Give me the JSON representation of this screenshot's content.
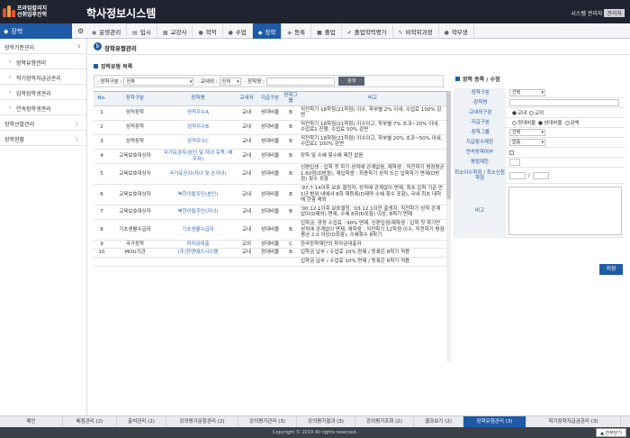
{
  "header": {
    "logo_line1": "프라임칼리지",
    "logo_line2": "선취업후진학",
    "system_title": "학사정보시스템",
    "user_label": "시스템 관리자",
    "user_name": "관리자"
  },
  "menubar": {
    "current": "장학",
    "items": [
      {
        "label": "운영관리",
        "icon": "◉"
      },
      {
        "label": "입시",
        "icon": "▤"
      },
      {
        "label": "교강사",
        "icon": "▦"
      },
      {
        "label": "학적",
        "icon": "●"
      },
      {
        "label": "수업",
        "icon": "●"
      },
      {
        "label": "장학",
        "icon": "◆"
      },
      {
        "label": "등록",
        "icon": "◈"
      },
      {
        "label": "졸업",
        "icon": "■"
      },
      {
        "label": "졸업학력평가",
        "icon": "✔"
      },
      {
        "label": "비학위과정",
        "icon": "✎"
      },
      {
        "label": "학부생",
        "icon": "●"
      }
    ]
  },
  "sidebar": {
    "items": [
      {
        "label": "장학기준관리",
        "type": "group",
        "chevron": "∨"
      },
      {
        "label": "장학유형관리",
        "type": "sub",
        "selected": true
      },
      {
        "label": "학기장학지급금관리",
        "type": "sub"
      },
      {
        "label": "입학장학생관리",
        "type": "sub"
      },
      {
        "label": "연속장학생관리",
        "type": "sub"
      },
      {
        "label": "장학선발관리",
        "type": "group",
        "chevron": "〉"
      },
      {
        "label": "장학현황",
        "type": "group",
        "chevron": "〉"
      }
    ]
  },
  "page": {
    "title": "장학유형관리",
    "list_title": "장학유형 목록",
    "form_title": "장학 등록 / 수정"
  },
  "filter": {
    "type_label": "· 장학구분 :",
    "type_value": "전체",
    "inout_label": "· 교내외 :",
    "inout_value": "전체",
    "name_label": "· 장학명 :",
    "search_button": "검색"
  },
  "table": {
    "headers": [
      "No.",
      "장학구분",
      "장학명",
      "교내외",
      "지급구분",
      "장학그룹",
      "비고"
    ],
    "rows": [
      [
        "1",
        "성적장학",
        "성적우수A",
        "교내",
        "성대비율",
        "B",
        "직전학기 18학점(21학점) 이수, 학부별 2% 이내, 수업료 100% 감면"
      ],
      [
        "2",
        "성적장학",
        "성적우수B",
        "교내",
        "성대비율",
        "B",
        "직전학기 18학점(21학점) 이수이고, 학부별 7% 초과~20% 이내, 수업료1 진행, 수업료 50% 감면"
      ],
      [
        "3",
        "성적장학",
        "성적우수C",
        "교내",
        "성대비율",
        "B",
        "직전학기 18학점(21학점) 이수이고, 학부별 20% 초과~50% 이내, 수업료1 100% 감면"
      ],
      [
        "4",
        "교육보호대상자",
        "국가유공자(본인 및 자녀 유족, 배우자)",
        "교내",
        "성대비율",
        "B",
        "장학 및 수혜 횟수에 제한 없음"
      ],
      [
        "5",
        "교육보호대상자",
        "국가유공자(자녀 및 손자녀)",
        "교내",
        "성대비율",
        "B",
        "선편입생 : 입학 첫 학기 성적에 관계없음, 재학생 : 직전학기 평점평균 1.60점(D방점), 재입학생 : 최종학기 성적 또는 입학학기 면제(D방점) 횟수 포함"
      ],
      [
        "6",
        "교육보호대상자",
        "북한이탈주민(본인)",
        "교내",
        "성대비율",
        "B",
        "'97.7.14이후 보호 결정자, 성적에 관계없이 면제, 최초 입학 기준 만 1년 범위 내에서 8회 재등록(D제약 수혜 횟수 포함), 국내 최초 대학에 한함 제외"
      ],
      [
        "7",
        "교육보호대상자",
        "북한이탈주민(자녀)",
        "교내",
        "성대비율",
        "B",
        "'00.12.1이후 보호결정, '03.12.1이전 출생자, 직전학기 성적 관계없이(D제외) 면제, 수혜 8회(D포함) 이상, 8학기 면제"
      ],
      [
        "8",
        "기초생활수급자",
        "기초생활수급자",
        "교내",
        "성대비율",
        "B",
        "입학금, 경정 수업료 : 90% 면제, 신편입생/재학생 : 입학 첫 학기만 성적에 관계없이 면제, 재학생 : 직전학기 12학점 이수, 직전학기 평점평균 2.0 이상(D포함), 수혜횟수 8학기"
      ],
      [
        "9",
        "국가장학",
        "학자금대출",
        "교외",
        "성대비율",
        "C",
        "한국장학재단의 학자금대출자"
      ],
      [
        "10",
        "MOU기관",
        "(주)한엔에스시스템",
        "교내",
        "정대비율",
        "B",
        "입학금 납부 / 수업료 10% 면제 / 등록은 8학기 적용"
      ]
    ],
    "partial_row": "입학금 납부 / 수업료 10% 면제 / 등록은 8학기 적용"
  },
  "form": {
    "fields": [
      {
        "label": "·장학구분",
        "kind": "select",
        "value": "선택"
      },
      {
        "label": "·장학명",
        "kind": "input"
      },
      {
        "label": "·교내외구분",
        "kind": "radio",
        "options": [
          "교내",
          "교외"
        ],
        "selected": 0
      },
      {
        "label": "·지급구분",
        "kind": "radio",
        "options": [
          "정대비율",
          "성대비율",
          "금액"
        ],
        "selected": 1
      },
      {
        "label": "·장학그룹",
        "kind": "select",
        "value": "선택"
      },
      {
        "label": "지급횟수제한",
        "kind": "select",
        "value": "없음"
      },
      {
        "label": "연속장학여부",
        "kind": "checkbox"
      },
      {
        "label": "평점제한",
        "kind": "input"
      },
      {
        "label": "최소이수학점 / 최소신청학점",
        "kind": "pair",
        "sep": "/"
      }
    ],
    "remark_label": "비고",
    "save_button": "저장"
  },
  "bottom_tabs": [
    {
      "label": "메인",
      "active": false
    },
    {
      "label": "배점관리 (2)",
      "active": false
    },
    {
      "label": "출석관리 (2)",
      "active": false
    },
    {
      "label": "강의평가문항관리 (2)",
      "active": false
    },
    {
      "label": "강의평가관리 (3)",
      "active": false
    },
    {
      "label": "강의평가결과 (3)",
      "active": false
    },
    {
      "label": "강의평가조회 (2)",
      "active": false
    },
    {
      "label": "결과보기 (2)",
      "active": false
    },
    {
      "label": "장학유형관리 (3)",
      "active": true
    },
    {
      "label": "학기장학지급금관리 (3)",
      "active": false
    }
  ],
  "footer": {
    "copyright": "Copyright © 2019 All rights reserved.",
    "top_button": "▲ 전부닫기"
  },
  "colors": {
    "header": "#1f2430",
    "accent": "#1f5aa6"
  }
}
